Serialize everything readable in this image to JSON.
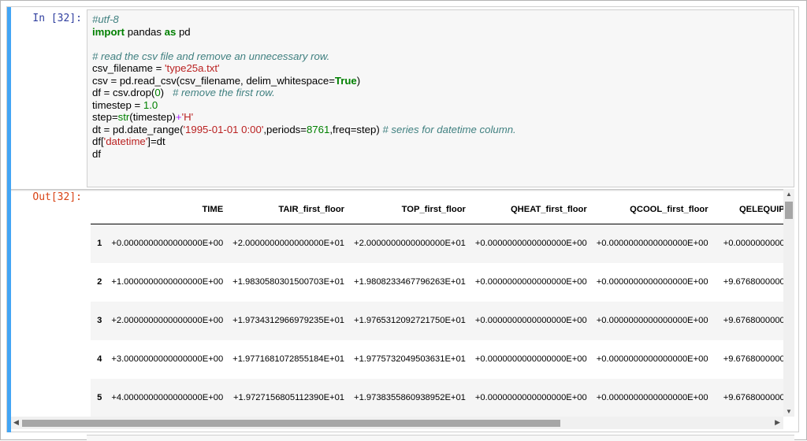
{
  "input_prompt": "In [32]:",
  "output_prompt": "Out[32]:",
  "code_lines": [
    [
      {
        "t": "#utf-8",
        "c": "cm"
      }
    ],
    [
      {
        "t": "import",
        "c": "kw"
      },
      {
        "t": " pandas "
      },
      {
        "t": "as",
        "c": "kw"
      },
      {
        "t": " pd"
      }
    ],
    [
      {
        "t": ""
      }
    ],
    [
      {
        "t": "# read the csv file and remove an unnecessary row.",
        "c": "cm"
      }
    ],
    [
      {
        "t": "csv_filename "
      },
      {
        "t": "= "
      },
      {
        "t": "'type25a.txt'",
        "c": "st"
      }
    ],
    [
      {
        "t": "csv "
      },
      {
        "t": "= "
      },
      {
        "t": "pd.read_csv(csv_filename, delim_whitespace"
      },
      {
        "t": "="
      },
      {
        "t": "True",
        "c": "kw"
      },
      {
        "t": ")"
      }
    ],
    [
      {
        "t": "df "
      },
      {
        "t": "= "
      },
      {
        "t": "csv.drop("
      },
      {
        "t": "0",
        "c": "nu"
      },
      {
        "t": ")   "
      },
      {
        "t": "# remove the first row.",
        "c": "cm"
      }
    ],
    [
      {
        "t": "timestep "
      },
      {
        "t": "= "
      },
      {
        "t": "1.0",
        "c": "nu"
      }
    ],
    [
      {
        "t": "step"
      },
      {
        "t": "="
      },
      {
        "t": "str",
        "c": "bi"
      },
      {
        "t": "(timestep)"
      },
      {
        "t": "+",
        "c": "op"
      },
      {
        "t": "'H'",
        "c": "st"
      }
    ],
    [
      {
        "t": "dt "
      },
      {
        "t": "= "
      },
      {
        "t": "pd.date_range("
      },
      {
        "t": "'1995-01-01 0:00'",
        "c": "st"
      },
      {
        "t": ",periods"
      },
      {
        "t": "="
      },
      {
        "t": "8761",
        "c": "nu"
      },
      {
        "t": ",freq"
      },
      {
        "t": "="
      },
      {
        "t": "step) "
      },
      {
        "t": "# series for datetime column.",
        "c": "cm"
      }
    ],
    [
      {
        "t": "df["
      },
      {
        "t": "'datetime'",
        "c": "st"
      },
      {
        "t": "]"
      },
      {
        "t": "="
      },
      {
        "t": "dt"
      }
    ],
    [
      {
        "t": "df"
      }
    ]
  ],
  "table": {
    "columns": [
      "TIME",
      "TAIR_first_floor",
      "TOP_first_floor",
      "QHEAT_first_floor",
      "QCOOL_first_floor",
      "QELEQUIP_"
    ],
    "rows": [
      {
        "index": "1",
        "cells": [
          "+0.0000000000000000E+00",
          "+2.0000000000000000E+01",
          "+2.0000000000000000E+01",
          "+0.0000000000000000E+00",
          "+0.0000000000000000E+00",
          "+0.00000000000"
        ]
      },
      {
        "index": "2",
        "cells": [
          "+1.0000000000000000E+00",
          "+1.9830580301500703E+01",
          "+1.9808233467796263E+01",
          "+0.0000000000000000E+00",
          "+0.0000000000000000E+00",
          "+9.67680000000"
        ]
      },
      {
        "index": "3",
        "cells": [
          "+2.0000000000000000E+00",
          "+1.9734312966979235E+01",
          "+1.9765312092721750E+01",
          "+0.0000000000000000E+00",
          "+0.0000000000000000E+00",
          "+9.67680000000"
        ]
      },
      {
        "index": "4",
        "cells": [
          "+3.0000000000000000E+00",
          "+1.9771681072855184E+01",
          "+1.9775732049503631E+01",
          "+0.0000000000000000E+00",
          "+0.0000000000000000E+00",
          "+9.67680000000"
        ]
      },
      {
        "index": "5",
        "cells": [
          "+4.0000000000000000E+00",
          "+1.9727156805112390E+01",
          "+1.9738355860938952E+01",
          "+0.0000000000000000E+00",
          "+0.0000000000000000E+00",
          "+9.67680000000"
        ]
      }
    ]
  },
  "icons": {
    "scroll_up": "▲",
    "scroll_down": "▼",
    "scroll_left": "◀",
    "scroll_right": "▶"
  },
  "colors": {
    "cell_accent": "#42a5f5",
    "input_prompt": "#303f9f",
    "output_prompt": "#d84315"
  }
}
